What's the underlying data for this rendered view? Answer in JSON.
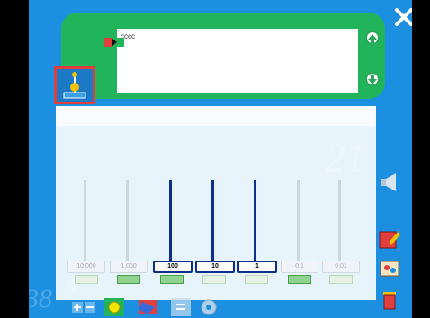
{
  "display": {
    "text": "cccc"
  },
  "abacus": {
    "places": [
      {
        "label": "10,000",
        "active": false
      },
      {
        "label": "1,000",
        "active": false
      },
      {
        "label": "100",
        "active": true
      },
      {
        "label": "10",
        "active": true
      },
      {
        "label": "1",
        "active": true
      },
      {
        "label": "0.1",
        "active": false
      },
      {
        "label": "0.01",
        "active": false
      }
    ]
  },
  "corner_label": "3",
  "colors": {
    "stage": "#1d8fe0",
    "panel": "#22b45a",
    "rod_active": "#0b2f8a",
    "tool_border": "#e13e3e"
  }
}
